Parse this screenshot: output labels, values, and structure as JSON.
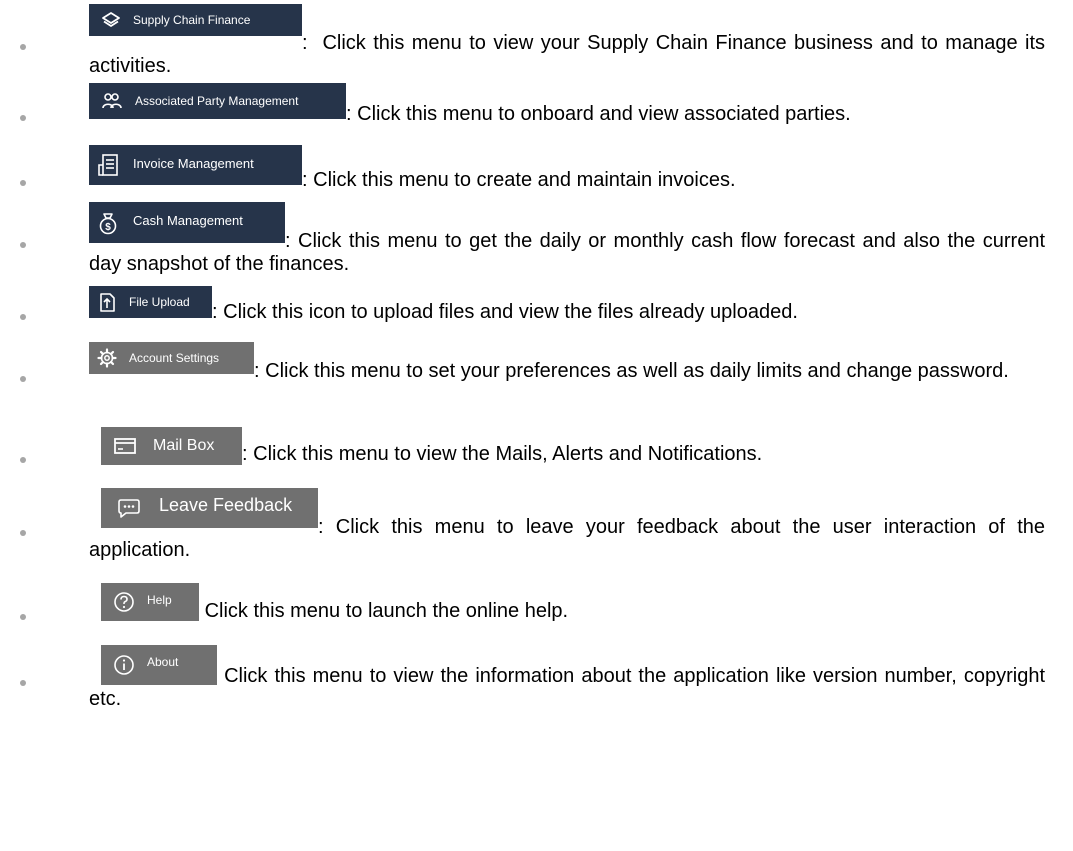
{
  "colors": {
    "menu_dark": "#26344a",
    "menu_grey": "#707070",
    "bullet": "#a6a6a6",
    "text": "#000000"
  },
  "items": [
    {
      "label": "Supply Chain Finance",
      "icon": "layers-icon",
      "lead": ":  ",
      "text": "Click this menu to view your Supply Chain Finance business and to manage its activities."
    },
    {
      "label": "Associated Party Management",
      "icon": "users-icon",
      "lead": ": ",
      "text": "Click this menu to onboard and view associated parties."
    },
    {
      "label": "Invoice Management",
      "icon": "invoice-icon",
      "lead": ": ",
      "text": "Click this menu to create and maintain invoices."
    },
    {
      "label": "Cash Management",
      "icon": "money-bag-icon",
      "lead": ": ",
      "text": "Click this menu to get the daily or monthly cash flow forecast and also the current day snapshot of the finances."
    },
    {
      "label": "File Upload",
      "icon": "upload-icon",
      "lead": ": ",
      "text": "Click this icon to upload files and view the files already uploaded."
    },
    {
      "label": "Account Settings",
      "icon": "gear-icon",
      "lead": ": ",
      "text": "Click this menu to set your preferences as well as daily limits and change password."
    },
    {
      "label": "Mail Box",
      "icon": "mailbox-icon",
      "lead": ": ",
      "text": "Click this menu to view the Mails, Alerts and Notifications."
    },
    {
      "label": "Leave Feedback",
      "icon": "chat-icon",
      "lead": ": ",
      "text": "Click this menu to leave your feedback about the user interaction of the application."
    },
    {
      "label": "Help",
      "icon": "help-icon",
      "lead": " ",
      "text": "Click this menu to launch the online help."
    },
    {
      "label": "About",
      "icon": "info-icon",
      "lead": " ",
      "text": "Click this menu to view the information about the application like version number, copyright etc."
    }
  ]
}
